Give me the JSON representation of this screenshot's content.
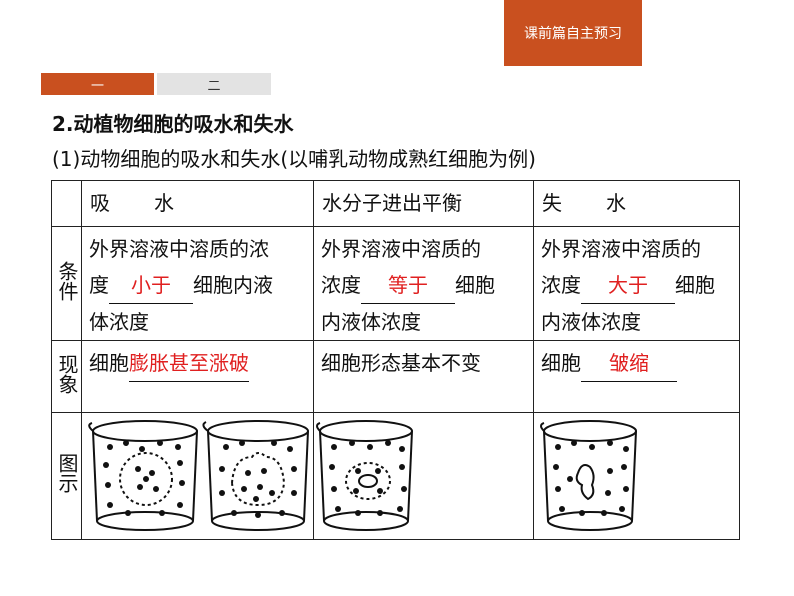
{
  "badge": "课前篇自主预习",
  "tabs": [
    "一",
    "二"
  ],
  "heading": "2.动植物细胞的吸水和失水",
  "subheading": "(1)动物细胞的吸水和失水(以哺乳动物成熟红细胞为例)",
  "table": {
    "columns": [
      "吸　水",
      "水分子进出平衡",
      "失　水"
    ],
    "rows": {
      "condition": {
        "label": "条件",
        "prefix_line1": "外界溶液中溶质的浓",
        "prefix_other": "外界溶液中溶质的",
        "du": "度",
        "nongdu": "浓度",
        "suffix": "细胞内液",
        "suffix_other": "细胞",
        "tail_1": "体浓度",
        "tail_other": "内液体浓度",
        "answers": [
          "小于",
          "等于",
          "大于"
        ]
      },
      "phenomenon": {
        "label": "现象",
        "prefix": "细胞",
        "answers": [
          "膨胀甚至涨破",
          "",
          "皱缩"
        ],
        "middle": "细胞形态基本不变"
      },
      "figure": {
        "label": "图示"
      }
    }
  },
  "colors": {
    "accent": "#c9501f",
    "answer": "#e02020"
  }
}
